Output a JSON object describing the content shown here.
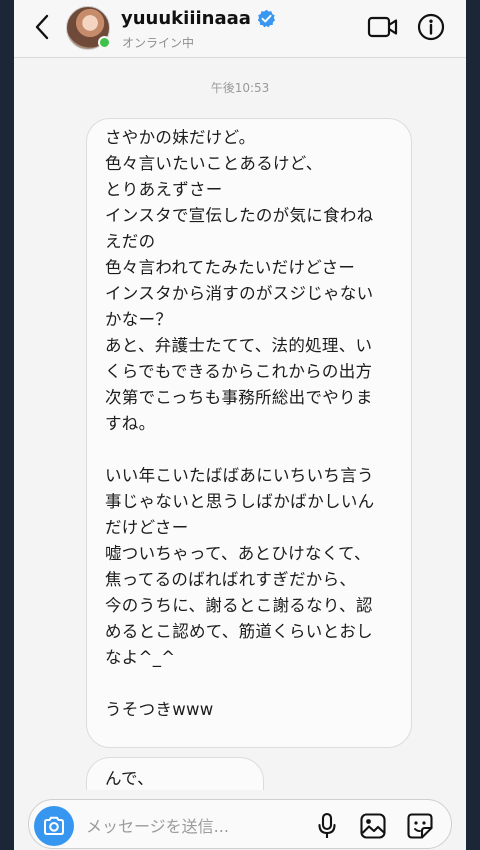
{
  "header": {
    "username": "yuuukiiinaaa",
    "status": "オンライン中",
    "icons": {
      "back": "chevron-left-icon",
      "verified": "verified-badge-icon",
      "video": "video-camera-icon",
      "info": "info-icon"
    }
  },
  "thread": {
    "timestamp": "午後10:53",
    "messages": [
      {
        "text": "さやかの妹だけど。\n色々言いたいことあるけど、\nとりあえずさー\nインスタで宣伝したのが気に食わね\nえだの\n色々言われてたみたいだけどさー\nインスタから消すのがスジじゃない\nかなー？\nあと、弁護士たてて、法的処理、い\nくらでもできるからこれからの出方\n次第でこっちも事務所総出でやりま\nすね。\n\nいい年こいたばばあにいちいち言う\n事じゃないと思うしばかばかしいん\nだけどさー\n嘘ついちゃって、あとひけなくて、\n焦ってるのばればれすぎだから、\n今のうちに、謝るとこ謝るなり、認\nめるとこ認めて、筋道くらいとおし\nなよ^_^\n\nうそつきwww"
      },
      {
        "text": "んで、"
      }
    ]
  },
  "composer": {
    "placeholder": "メッセージを送信...",
    "value": "",
    "icons": {
      "camera": "camera-icon",
      "mic": "microphone-icon",
      "gallery": "image-gallery-icon",
      "sticker": "sticker-icon"
    }
  },
  "colors": {
    "accent": "#3797f0",
    "online": "#3fc24b",
    "verified": "#3897f0"
  }
}
